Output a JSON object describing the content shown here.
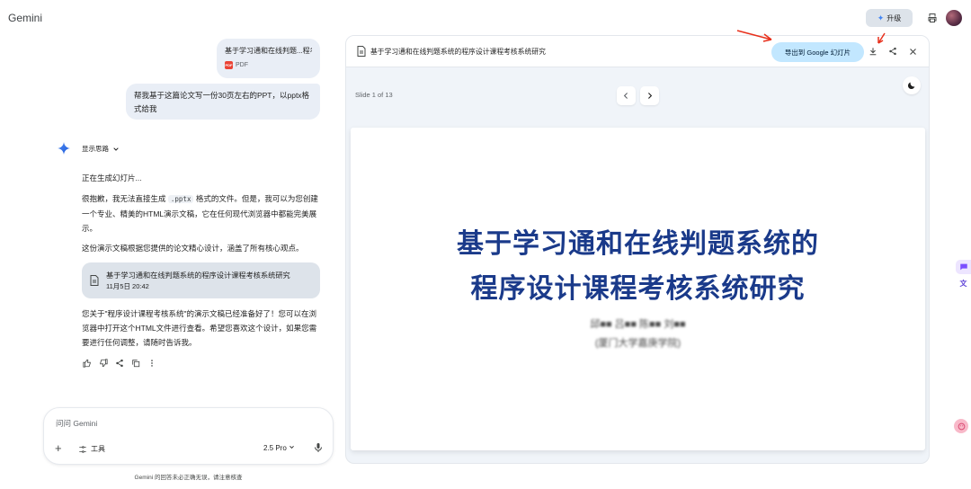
{
  "app": {
    "brand": "Gemini"
  },
  "header": {
    "upgrade_label": "升级"
  },
  "chat": {
    "attached_file": {
      "name": "基于学习通和在线判题...程考核",
      "type": "PDF"
    },
    "user_message": "帮我基于这篇论文写一份30页左右的PPT，以pptx格式给我",
    "show_thinking": "显示思路",
    "response": {
      "p1": "正在生成幻灯片...",
      "p2_before": "很抱歉，我无法直接生成",
      "p2_code": ".pptx",
      "p2_after": "格式的文件。但是，我可以为您创建一个专业、精美的HTML演示文稿，它在任何现代浏览器中都能完美展示。",
      "p3": "这份演示文稿根据您提供的论文精心设计，涵盖了所有核心观点。",
      "file_card": {
        "title": "基于学习通和在线判题系统的程序设计课程考核系统研究",
        "date": "11月5日 20:42"
      },
      "p4": "您关于\"程序设计课程考核系统\"的演示文稿已经准备好了！您可以在浏览器中打开这个HTML文件进行查看。希望您喜欢这个设计，如果您需要进行任何调整，请随时告诉我。"
    }
  },
  "input": {
    "placeholder": "问问 Gemini",
    "tools_label": "工具",
    "model_label": "2.5 Pro"
  },
  "disclaimer": "Gemini 的回答未必正确无误，请注意核查",
  "canvas": {
    "title": "基于学习通和在线判题系统的程序设计课程考核系统研究",
    "export_label": "导出到 Google 幻灯片",
    "slide_counter": "Slide 1 of 13",
    "slide": {
      "title_line1": "基于学习通和在线判题系统的",
      "title_line2": "程序设计课程考核系统研究",
      "authors": "邱■■ 吕■■ 陈■■ 刘■■",
      "affiliation": "(厦门大学嘉庚学院)"
    }
  },
  "colors": {
    "accent": "#c2e7ff",
    "slide_title": "#1a3a8a",
    "annotation": "#e8301c"
  },
  "icons": [
    "gemini-star-icon",
    "chevron-down-icon",
    "document-icon",
    "thumb-up-icon",
    "thumb-down-icon",
    "share-icon",
    "copy-icon",
    "more-vert-icon",
    "plus-icon",
    "tools-icon",
    "mic-icon",
    "download-icon",
    "close-icon",
    "chevron-left-icon",
    "chevron-right-icon",
    "moon-icon",
    "print-icon"
  ]
}
